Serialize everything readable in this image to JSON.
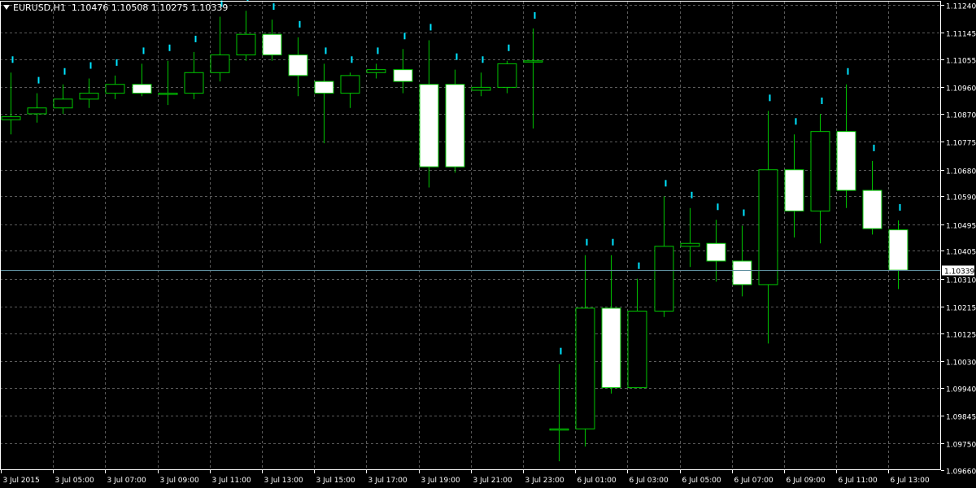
{
  "symbol": "EURUSD,H1",
  "ohlc_text": "1.10476 1.10508 1.10275 1.10339",
  "current_price_label": "1.10339",
  "colors": {
    "background": "#000000",
    "grid": "#5a5a5a",
    "bull_fill": "#000000",
    "bear_fill": "#ffffff",
    "candle_outline": "#00c800",
    "wick": "#00c800",
    "current_line": "#5f8f9f",
    "current_label_bg": "#ffffff",
    "axis_text": "#ffffff",
    "tick_mark": "#00e5ff"
  },
  "chart_data": {
    "type": "candlestick",
    "title": "EURUSD,H1",
    "grid": true,
    "ylim": [
      1.0966,
      1.1124
    ],
    "y_ticks": [
      "1.11240",
      "1.11145",
      "1.11055",
      "1.10960",
      "1.10870",
      "1.10775",
      "1.10680",
      "1.10590",
      "1.10495",
      "1.10405",
      "1.10310",
      "1.10215",
      "1.10125",
      "1.10030",
      "1.09940",
      "1.09845",
      "1.09750",
      "1.09660"
    ],
    "x_ticks": [
      "3 Jul 2015",
      "3 Jul 05:00",
      "3 Jul 07:00",
      "3 Jul 09:00",
      "3 Jul 11:00",
      "3 Jul 13:00",
      "3 Jul 15:00",
      "3 Jul 17:00",
      "3 Jul 19:00",
      "3 Jul 21:00",
      "3 Jul 23:00",
      "6 Jul 01:00",
      "6 Jul 03:00",
      "6 Jul 05:00",
      "6 Jul 07:00",
      "6 Jul 09:00",
      "6 Jul 11:00",
      "6 Jul 13:00"
    ],
    "current_price": 1.10339,
    "candles": [
      {
        "time": "3 Jul 03:00",
        "open": 1.1085,
        "high": 1.1101,
        "low": 1.108,
        "close": 1.1086
      },
      {
        "time": "3 Jul 04:00",
        "open": 1.1087,
        "high": 1.1094,
        "low": 1.1084,
        "close": 1.1089
      },
      {
        "time": "3 Jul 05:00",
        "open": 1.1089,
        "high": 1.1097,
        "low": 1.1087,
        "close": 1.1092
      },
      {
        "time": "3 Jul 06:00",
        "open": 1.1092,
        "high": 1.1099,
        "low": 1.1089,
        "close": 1.1094
      },
      {
        "time": "3 Jul 07:00",
        "open": 1.1094,
        "high": 1.11,
        "low": 1.1092,
        "close": 1.1097
      },
      {
        "time": "3 Jul 08:00",
        "open": 1.1097,
        "high": 1.1104,
        "low": 1.1093,
        "close": 1.1094
      },
      {
        "time": "3 Jul 09:00",
        "open": 1.1094,
        "high": 1.1105,
        "low": 1.109,
        "close": 1.1094
      },
      {
        "time": "3 Jul 10:00",
        "open": 1.1094,
        "high": 1.1108,
        "low": 1.1092,
        "close": 1.1101
      },
      {
        "time": "3 Jul 11:00",
        "open": 1.1101,
        "high": 1.112,
        "low": 1.1098,
        "close": 1.1107
      },
      {
        "time": "3 Jul 12:00",
        "open": 1.1107,
        "high": 1.1122,
        "low": 1.1105,
        "close": 1.1114
      },
      {
        "time": "3 Jul 13:00",
        "open": 1.1114,
        "high": 1.1119,
        "low": 1.1105,
        "close": 1.1107
      },
      {
        "time": "3 Jul 14:00",
        "open": 1.1107,
        "high": 1.1113,
        "low": 1.1093,
        "close": 1.11
      },
      {
        "time": "3 Jul 15:00",
        "open": 1.1098,
        "high": 1.1104,
        "low": 1.1077,
        "close": 1.1094
      },
      {
        "time": "3 Jul 16:00",
        "open": 1.1094,
        "high": 1.1101,
        "low": 1.1089,
        "close": 1.11
      },
      {
        "time": "3 Jul 17:00",
        "open": 1.1101,
        "high": 1.1104,
        "low": 1.1099,
        "close": 1.1102
      },
      {
        "time": "3 Jul 18:00",
        "open": 1.1102,
        "high": 1.1109,
        "low": 1.1094,
        "close": 1.1098
      },
      {
        "time": "3 Jul 19:00",
        "open": 1.1097,
        "high": 1.1112,
        "low": 1.1062,
        "close": 1.1069
      },
      {
        "time": "3 Jul 20:00",
        "open": 1.1097,
        "high": 1.1102,
        "low": 1.1067,
        "close": 1.1069
      },
      {
        "time": "3 Jul 21:00",
        "open": 1.1095,
        "high": 1.1101,
        "low": 1.1093,
        "close": 1.1096
      },
      {
        "time": "3 Jul 22:00",
        "open": 1.1096,
        "high": 1.1105,
        "low": 1.1094,
        "close": 1.1104
      },
      {
        "time": "3 Jul 23:00",
        "open": 1.1105,
        "high": 1.1116,
        "low": 1.1082,
        "close": 1.1105
      },
      {
        "time": "6 Jul 00:00",
        "open": 1.098,
        "high": 1.1002,
        "low": 1.0969,
        "close": 1.098
      },
      {
        "time": "6 Jul 01:00",
        "open": 1.098,
        "high": 1.1039,
        "low": 1.0974,
        "close": 1.1021
      },
      {
        "time": "6 Jul 02:00",
        "open": 1.1021,
        "high": 1.1039,
        "low": 1.0992,
        "close": 1.0994
      },
      {
        "time": "6 Jul 03:00",
        "open": 1.0994,
        "high": 1.1031,
        "low": 1.0994,
        "close": 1.102
      },
      {
        "time": "6 Jul 04:00",
        "open": 1.102,
        "high": 1.1059,
        "low": 1.1018,
        "close": 1.1042
      },
      {
        "time": "6 Jul 05:00",
        "open": 1.1042,
        "high": 1.1055,
        "low": 1.1035,
        "close": 1.1043
      },
      {
        "time": "6 Jul 06:00",
        "open": 1.1043,
        "high": 1.1051,
        "low": 1.103,
        "close": 1.1037
      },
      {
        "time": "6 Jul 07:00",
        "open": 1.1037,
        "high": 1.1049,
        "low": 1.1025,
        "close": 1.1029
      },
      {
        "time": "6 Jul 08:00",
        "open": 1.1029,
        "high": 1.1088,
        "low": 1.1009,
        "close": 1.1068
      },
      {
        "time": "6 Jul 09:00",
        "open": 1.1068,
        "high": 1.108,
        "low": 1.1045,
        "close": 1.1054
      },
      {
        "time": "6 Jul 10:00",
        "open": 1.1054,
        "high": 1.1087,
        "low": 1.1043,
        "close": 1.1081
      },
      {
        "time": "6 Jul 11:00",
        "open": 1.1081,
        "high": 1.1097,
        "low": 1.1055,
        "close": 1.1061
      },
      {
        "time": "6 Jul 12:00",
        "open": 1.1061,
        "high": 1.1071,
        "low": 1.1046,
        "close": 1.1048
      },
      {
        "time": "6 Jul 13:00",
        "open": 1.10476,
        "high": 1.10508,
        "low": 1.10275,
        "close": 1.10339
      }
    ]
  }
}
